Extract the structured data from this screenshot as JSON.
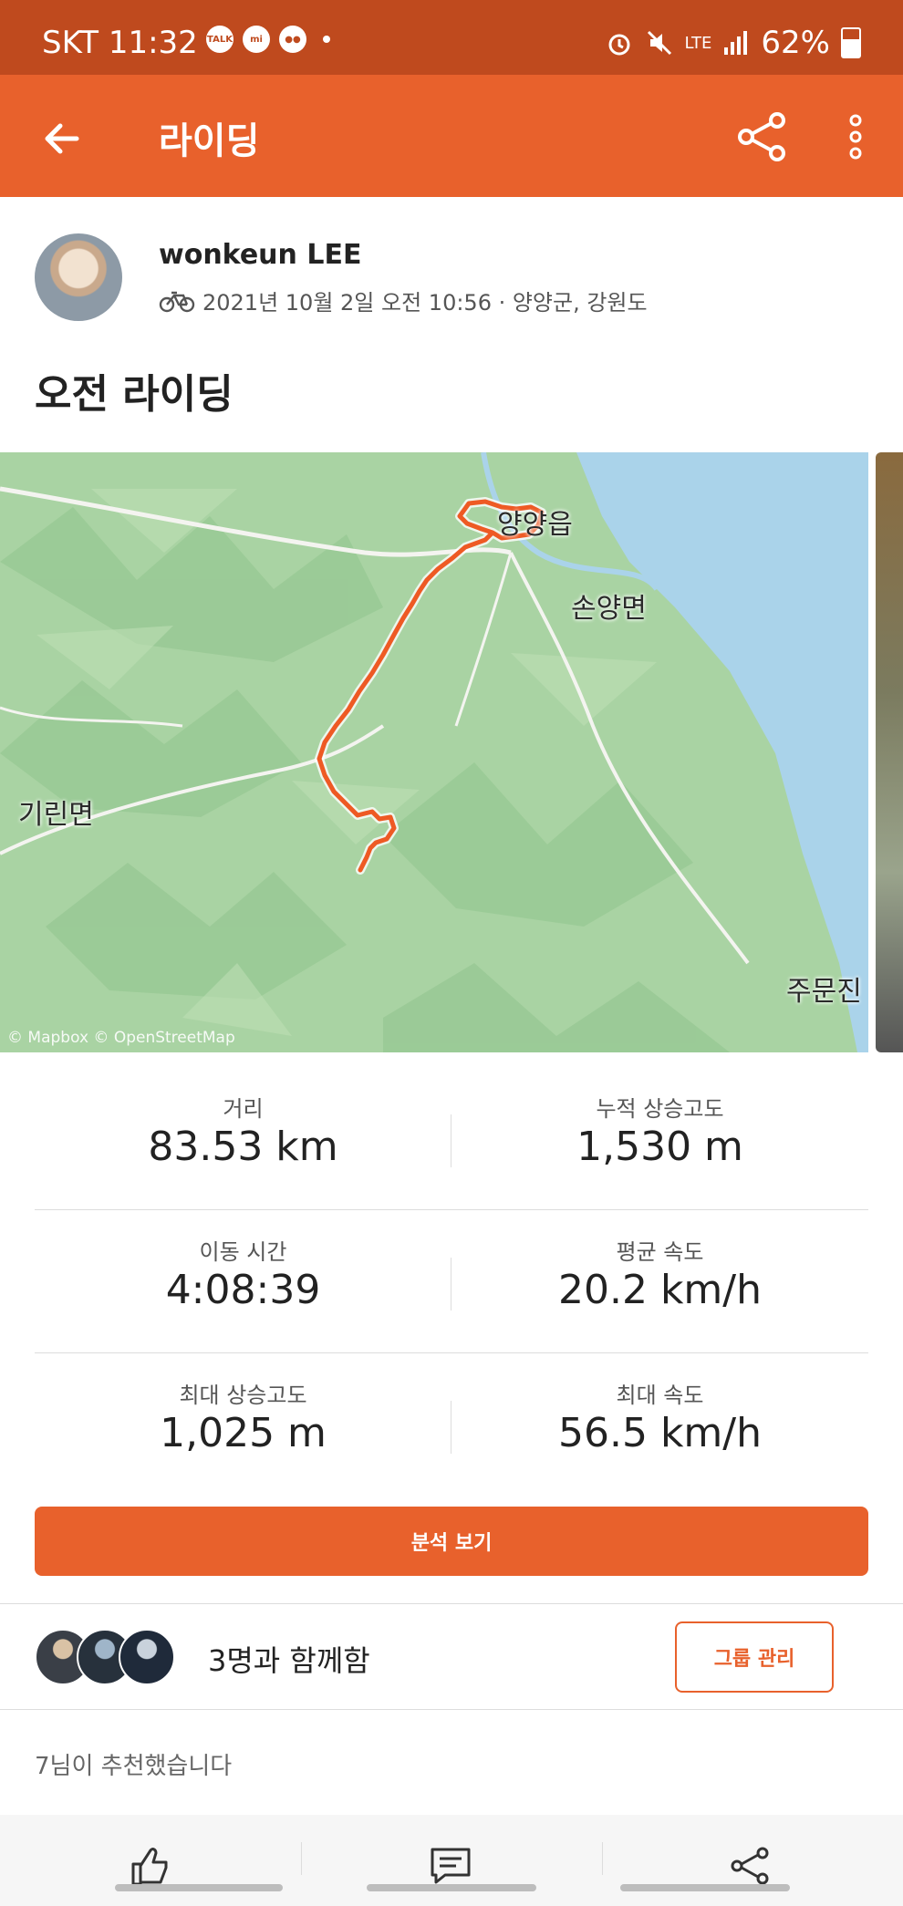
{
  "status_bar": {
    "carrier_time": "SKT 11:32",
    "notif_icons": [
      "talk-icon",
      "mi-icon",
      "wechat-icon"
    ],
    "net": "LTE",
    "battery": "62%"
  },
  "app_bar": {
    "title": "라이딩"
  },
  "activity": {
    "athlete": "wonkeun LEE",
    "date_location": "2021년 10월 2일 오전 10:56 · 양양군, 강원도",
    "title": "오전 라이딩"
  },
  "map": {
    "labels": [
      "양양읍",
      "손양면",
      "기린면",
      "주문진"
    ],
    "credit": "© Mapbox © OpenStreetMap",
    "colors": {
      "land": "#a8d2a2",
      "sea": "#aad3ea",
      "route": "#ee5a24"
    }
  },
  "stats": [
    {
      "label": "거리",
      "value": "83.53 km"
    },
    {
      "label": "누적 상승고도",
      "value": "1,530 m"
    },
    {
      "label": "이동 시간",
      "value": "4:08:39"
    },
    {
      "label": "평균 속도",
      "value": "20.2 km/h"
    },
    {
      "label": "최대 상승고도",
      "value": "1,025 m"
    },
    {
      "label": "최대 속도",
      "value": "56.5 km/h"
    }
  ],
  "analysis_button": "분석 보기",
  "group": {
    "text": "3명과 함께함",
    "button": "그룹 관리"
  },
  "kudos": "7님이 추천했습니다",
  "bottom_actions": [
    "thumbs-up-icon",
    "comment-icon",
    "share-icon"
  ],
  "accent": "#e8612c"
}
